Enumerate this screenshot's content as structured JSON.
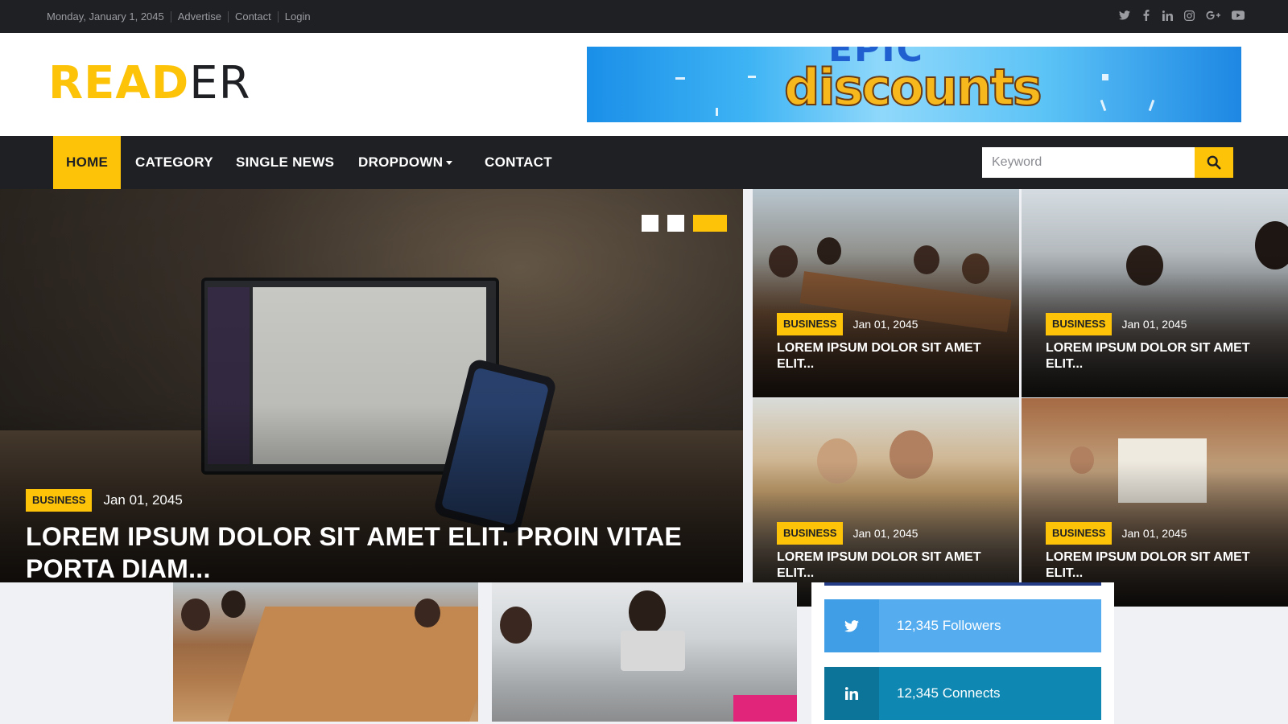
{
  "topbar": {
    "date": "Monday, January 1, 2045",
    "links": [
      "Advertise",
      "Contact",
      "Login"
    ],
    "social_icons": [
      "twitter-icon",
      "facebook-icon",
      "linkedin-icon",
      "instagram-icon",
      "google-plus-icon",
      "youtube-icon"
    ]
  },
  "header": {
    "logo_highlight": "READ",
    "logo_rest": "ER",
    "banner_top": "EPIC",
    "banner_main": "discounts"
  },
  "nav": {
    "items": [
      "HOME",
      "CATEGORY",
      "SINGLE NEWS",
      "DROPDOWN",
      "CONTACT"
    ],
    "active": "HOME",
    "search_placeholder": "Keyword"
  },
  "hero": {
    "category": "BUSINESS",
    "date": "Jan 01, 2045",
    "title": "LOREM IPSUM DOLOR SIT AMET ELIT. PROIN VITAE PORTA DIAM...",
    "slides": 3,
    "active_slide": 3
  },
  "grid": [
    {
      "category": "BUSINESS",
      "date": "Jan 01, 2045",
      "title": "LOREM IPSUM DOLOR SIT AMET ELIT..."
    },
    {
      "category": "BUSINESS",
      "date": "Jan 01, 2045",
      "title": "LOREM IPSUM DOLOR SIT AMET ELIT..."
    },
    {
      "category": "BUSINESS",
      "date": "Jan 01, 2045",
      "title": "LOREM IPSUM DOLOR SIT AMET ELIT..."
    },
    {
      "category": "BUSINESS",
      "date": "Jan 01, 2045",
      "title": "LOREM IPSUM DOLOR SIT AMET ELIT..."
    }
  ],
  "social_counts": [
    {
      "icon": "twitter-icon",
      "text": "12,345 Followers"
    },
    {
      "icon": "linkedin-icon",
      "text": "12,345 Connects"
    }
  ],
  "colors": {
    "accent": "#fcc308",
    "dark": "#1e2024",
    "twitter": "#55acee",
    "linkedin": "#0e88b2"
  }
}
